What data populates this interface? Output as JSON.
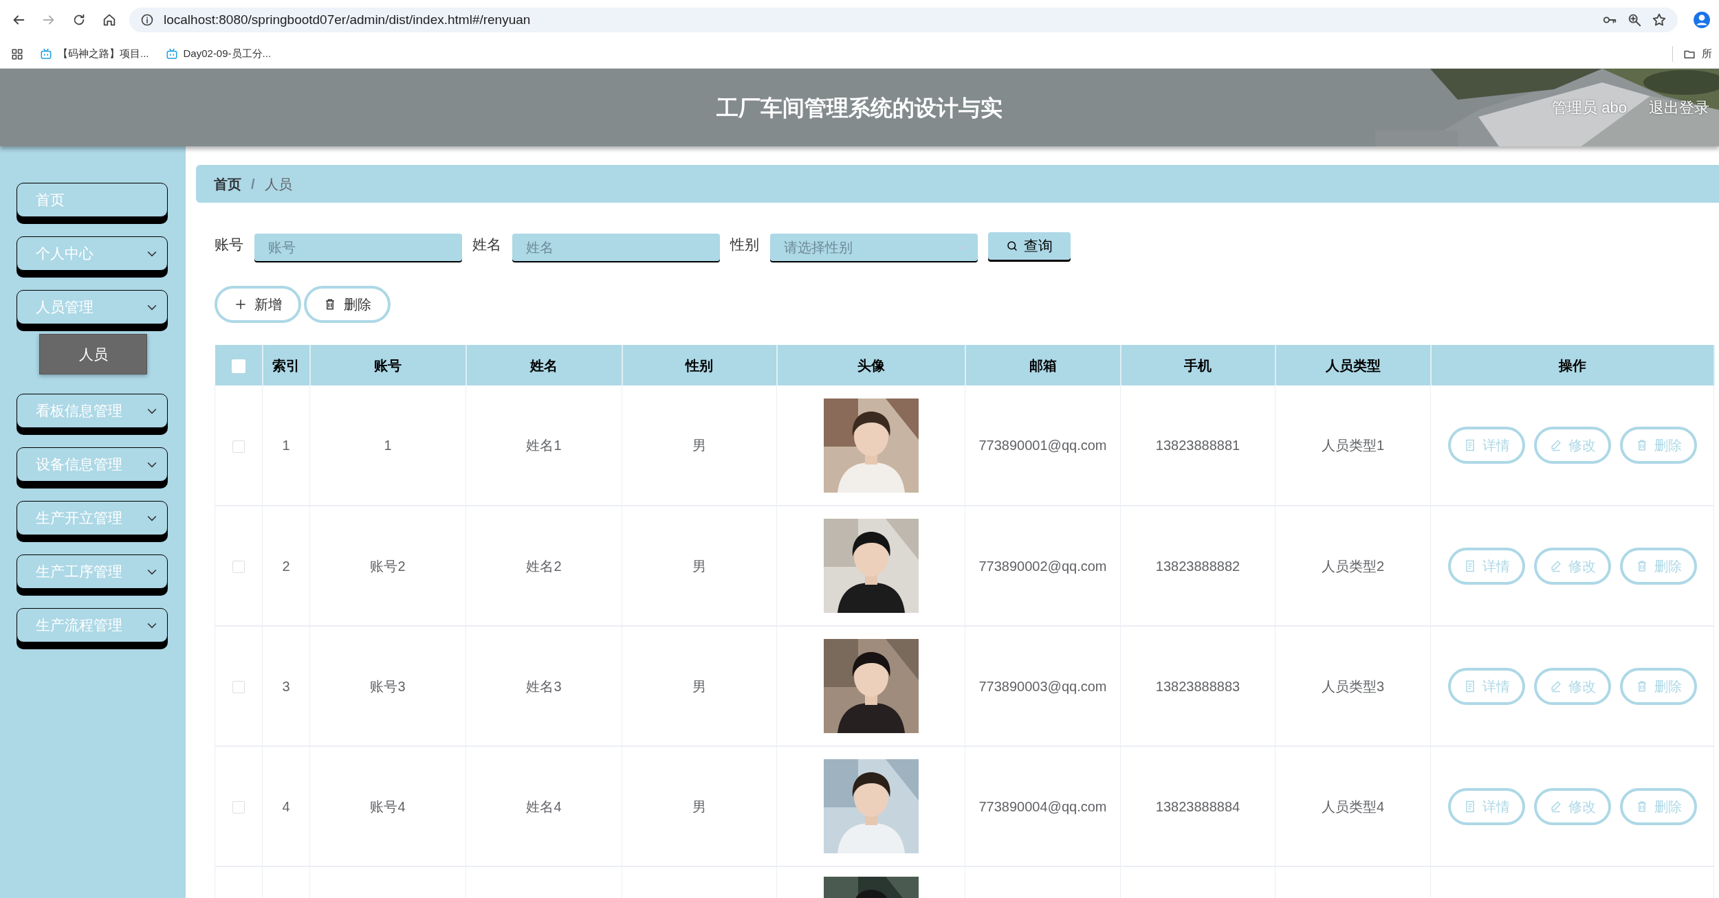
{
  "browser": {
    "nav_buttons": [
      {
        "kind": "back",
        "disabled": false
      },
      {
        "kind": "forward",
        "disabled": true
      },
      {
        "kind": "reload",
        "disabled": false
      },
      {
        "kind": "home",
        "disabled": false
      }
    ],
    "url": "localhost:8080/springbootd07er/admin/dist/index.html#/renyuan",
    "address_icons": [
      {
        "kind": "key"
      },
      {
        "kind": "zoom"
      },
      {
        "kind": "star"
      }
    ],
    "bookmarks": [
      {
        "kind": "apps"
      },
      {
        "kind": "site",
        "label": "【码神之路】项目..."
      },
      {
        "kind": "site",
        "label": "Day02-09-员工分..."
      }
    ],
    "other_bookmarks": "所"
  },
  "header": {
    "title": "工厂车间管理系统的设计与实",
    "user": "管理员 abo",
    "logout": "退出登录"
  },
  "sidebar": {
    "items": [
      {
        "label": "首页",
        "kind": "link"
      },
      {
        "label": "个人中心",
        "kind": "menu"
      },
      {
        "label": "人员管理",
        "kind": "menu",
        "children": [
          {
            "label": "人员",
            "selected": true
          }
        ]
      },
      {
        "label": "看板信息管理",
        "kind": "menu"
      },
      {
        "label": "设备信息管理",
        "kind": "menu"
      },
      {
        "label": "生产开立管理",
        "kind": "menu"
      },
      {
        "label": "生产工序管理",
        "kind": "menu"
      },
      {
        "label": "生产流程管理",
        "kind": "menu"
      }
    ]
  },
  "breadcrumb": [
    {
      "label": "首页",
      "current": false
    },
    {
      "label": "人员",
      "current": true
    }
  ],
  "breadcrumb_separator": "/",
  "search": {
    "fields": [
      {
        "kind": "text",
        "label": "账号",
        "placeholder": "账号"
      },
      {
        "kind": "text",
        "label": "姓名",
        "placeholder": "姓名"
      },
      {
        "kind": "select",
        "label": "性别",
        "placeholder": "请选择性别"
      }
    ],
    "button": "查询"
  },
  "toolbar": [
    {
      "kind": "add",
      "label": "新增"
    },
    {
      "kind": "delete",
      "label": "删除"
    }
  ],
  "table": {
    "columns": [
      {
        "kind": "checkbox",
        "checked": false
      },
      {
        "kind": "text",
        "label": "索引"
      },
      {
        "kind": "text",
        "label": "账号"
      },
      {
        "kind": "text",
        "label": "姓名"
      },
      {
        "kind": "text",
        "label": "性别"
      },
      {
        "kind": "text",
        "label": "头像"
      },
      {
        "kind": "text",
        "label": "邮箱"
      },
      {
        "kind": "text",
        "label": "手机"
      },
      {
        "kind": "text",
        "label": "人员类型"
      },
      {
        "kind": "text",
        "label": "操作"
      }
    ],
    "rows": [
      {
        "checked": false,
        "index": "1",
        "account": "1",
        "name": "姓名1",
        "gender": "男",
        "avatar": {
          "kind": "picture"
        },
        "email": "773890001@qq.com",
        "phone": "13823888881",
        "type": "人员类型1",
        "actions": [
          {
            "kind": "detail",
            "label": "详情"
          },
          {
            "kind": "edit",
            "label": "修改"
          },
          {
            "kind": "delete",
            "label": "删除"
          }
        ]
      },
      {
        "checked": false,
        "index": "2",
        "account": "账号2",
        "name": "姓名2",
        "gender": "男",
        "avatar": {
          "kind": "picture"
        },
        "email": "773890002@qq.com",
        "phone": "13823888882",
        "type": "人员类型2",
        "actions": [
          {
            "kind": "detail",
            "label": "详情"
          },
          {
            "kind": "edit",
            "label": "修改"
          },
          {
            "kind": "delete",
            "label": "删除"
          }
        ]
      },
      {
        "checked": false,
        "index": "3",
        "account": "账号3",
        "name": "姓名3",
        "gender": "男",
        "avatar": {
          "kind": "picture"
        },
        "email": "773890003@qq.com",
        "phone": "13823888883",
        "type": "人员类型3",
        "actions": [
          {
            "kind": "detail",
            "label": "详情"
          },
          {
            "kind": "edit",
            "label": "修改"
          },
          {
            "kind": "delete",
            "label": "删除"
          }
        ]
      },
      {
        "checked": false,
        "index": "4",
        "account": "账号4",
        "name": "姓名4",
        "gender": "男",
        "avatar": {
          "kind": "picture"
        },
        "email": "773890004@qq.com",
        "phone": "13823888884",
        "type": "人员类型4",
        "actions": [
          {
            "kind": "detail",
            "label": "详情"
          },
          {
            "kind": "edit",
            "label": "修改"
          },
          {
            "kind": "delete",
            "label": "删除"
          }
        ]
      }
    ],
    "partial_row": {
      "avatar": {
        "kind": "picture"
      }
    }
  }
}
